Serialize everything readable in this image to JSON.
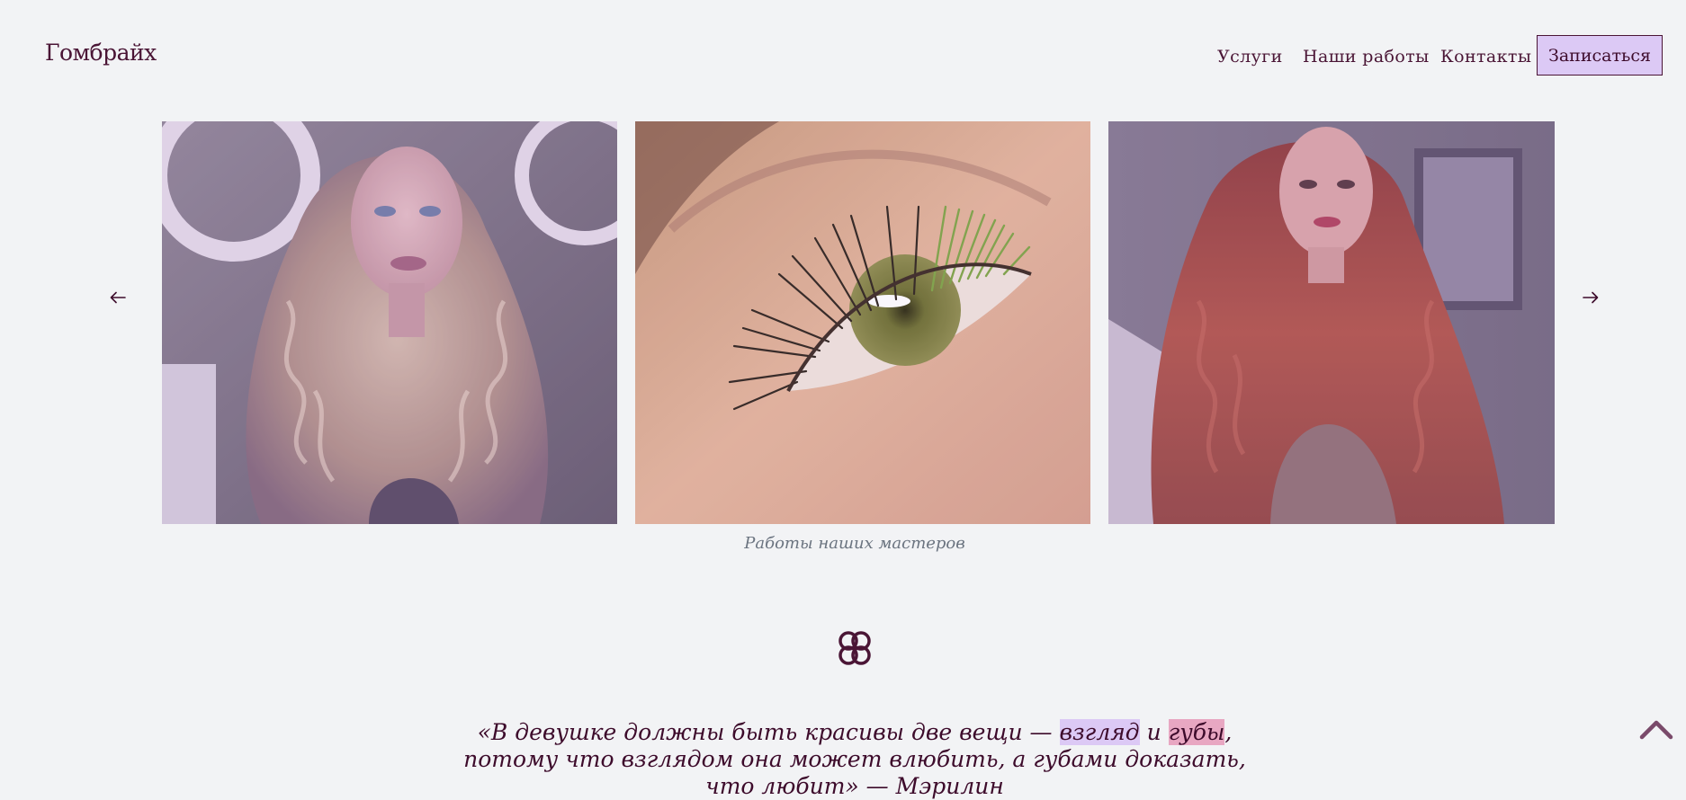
{
  "header": {
    "logo": "Гомбрайх",
    "nav": [
      "Услуги",
      "Наши работы",
      "Контакты"
    ],
    "cta": "Записаться"
  },
  "gallery": {
    "caption": "Работы наших мастеров",
    "images": [
      {
        "subject": "woman with long wavy blonde curls"
      },
      {
        "subject": "close-up of eyelash extensions with green tips"
      },
      {
        "subject": "woman with long wavy copper-red hair"
      }
    ]
  },
  "quote": {
    "before": "«В девушке должны быть красивы две вещи — ",
    "hl1": "взгляд",
    "mid": " и ",
    "hl2": "губы",
    "after": ", потому что взглядом она может влюбить, а губами доказать, что любит» — Мэрилин"
  },
  "colors": {
    "background": "#f2f3f5",
    "text": "#3d0b2b",
    "accent_lavender": "#dcc9f5",
    "accent_pink": "#e8a7c2",
    "caption": "#6b7480"
  }
}
